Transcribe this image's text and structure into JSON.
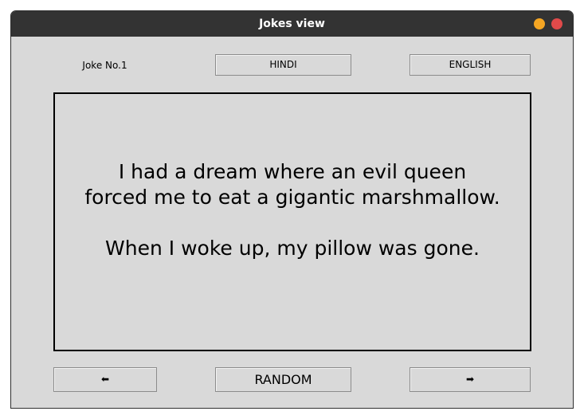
{
  "window": {
    "title": "Jokes view"
  },
  "header": {
    "joke_label": "Joke No.1",
    "hindi_label": "HINDI",
    "english_label": "ENGLISH"
  },
  "joke": {
    "text": "I had a dream where an evil queen\nforced me to eat a gigantic marshmallow.\n\nWhen I woke up, my pillow was gone."
  },
  "footer": {
    "prev_label": "⬅",
    "random_label": "RANDOM",
    "next_label": "➡"
  },
  "colors": {
    "titlebar": "#333333",
    "background": "#d9d9d9",
    "minimize": "#f5a623",
    "close": "#e04a4a"
  }
}
